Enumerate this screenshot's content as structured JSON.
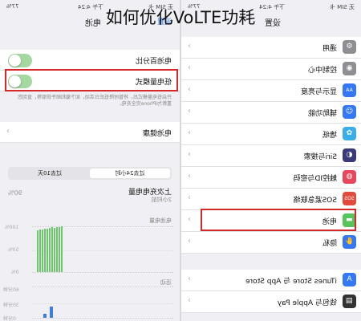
{
  "caption": "如何优化VoLTE功耗",
  "left": {
    "status_time": "下午 4:24",
    "status_battery": "77%",
    "status_carrier": "无 SIM 卡",
    "nav_back": "电池",
    "nav_title": "设置",
    "battery_percentage_label": "电池百分比",
    "low_power_label": "低电量模式",
    "low_power_note_1": "开启低电量模式后，将暂时降低后台活动，如下载和邮件获取等，直到您",
    "low_power_note_2": "重新为iPhone完全充电。",
    "battery_health_label": "电池健康",
    "tab_24h": "过去24小时",
    "tab_10d": "过去10天",
    "last_charged_label": "上次充电电量",
    "last_charged_time": "2小时前",
    "last_charged_value": "90%",
    "battery_level_header": "电池电量",
    "activity_header": "活动",
    "tick_100": "100%",
    "tick_50": "50%",
    "tick_0": "0%",
    "tick_60m": "60分钟",
    "tick_30m": "30分钟",
    "tick_0m": "0分钟",
    "level_values": [
      0.98,
      0.97,
      0.96,
      0.95,
      0.96,
      0.94,
      0.93,
      0.93,
      0.92,
      0.91,
      0.9
    ],
    "activity_values": [
      0.35,
      0.12
    ],
    "green": "#6cc76a",
    "blue": "#3f7de0"
  },
  "right": {
    "status_time": "下午 4:24",
    "status_battery": "77%",
    "status_carrier": "无 SIM 卡",
    "nav_title": "设置",
    "items_group1": [
      {
        "label": "通用",
        "icon": "gear-icon",
        "color": "#8e8e93",
        "glyph": "⚙"
      },
      {
        "label": "控制中心",
        "icon": "control-center-icon",
        "color": "#8e8e93",
        "glyph": "◉"
      },
      {
        "label": "显示与亮度",
        "icon": "display-icon",
        "color": "#3478f6",
        "glyph": "AA"
      },
      {
        "label": "辅助功能",
        "icon": "accessibility-icon",
        "color": "#3478f6",
        "glyph": "☺"
      },
      {
        "label": "墙纸",
        "icon": "wallpaper-icon",
        "color": "#39aee8",
        "glyph": "✿"
      },
      {
        "label": "Siri与搜索",
        "icon": "siri-icon",
        "color": "#3a3a7a",
        "glyph": "◐"
      },
      {
        "label": "触控ID与密码",
        "icon": "touch-id-icon",
        "color": "#e8465c",
        "glyph": "◍"
      },
      {
        "label": "SOS紧急联络",
        "icon": "sos-icon",
        "color": "#e24a3c",
        "glyph": "SOS"
      },
      {
        "label": "电池",
        "icon": "battery-icon",
        "color": "#55c45a",
        "glyph": "▬"
      },
      {
        "label": "隐私",
        "icon": "privacy-icon",
        "color": "#3478f6",
        "glyph": "✋"
      }
    ],
    "items_group2": [
      {
        "label": "iTunes Store 与 App Store",
        "icon": "app-store-icon",
        "color": "#3478f6",
        "glyph": "A"
      },
      {
        "label": "钱包与 Apple Pay",
        "icon": "wallet-icon",
        "color": "#333333",
        "glyph": "▤"
      }
    ]
  }
}
